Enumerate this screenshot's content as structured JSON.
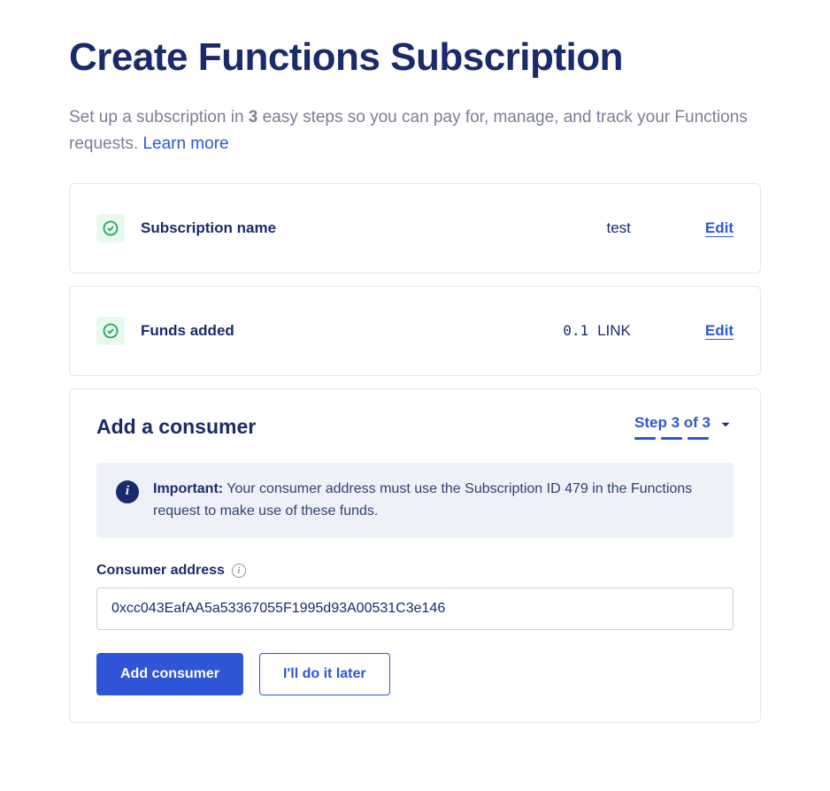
{
  "header": {
    "title": "Create Functions Subscription",
    "subtitle_prefix": "Set up a subscription in ",
    "subtitle_bold": "3",
    "subtitle_suffix": " easy steps so you can pay for, manage, and track your Functions requests. ",
    "learn_more": "Learn more"
  },
  "steps": [
    {
      "label": "Subscription name",
      "value": "test",
      "edit": "Edit"
    },
    {
      "label": "Funds added",
      "amount": "0.1",
      "unit": "LINK",
      "edit": "Edit"
    }
  ],
  "current_step": {
    "title": "Add a consumer",
    "indicator": "Step 3 of 3",
    "banner_strong": "Important:",
    "banner_text": " Your consumer address must use the Subscription ID 479 in the Functions request to make use of these funds.",
    "field_label": "Consumer address",
    "field_value": "0xcc043EafAA5a53367055F1995d93A00531C3e146",
    "primary_btn": "Add consumer",
    "secondary_btn": "I'll do it later"
  }
}
